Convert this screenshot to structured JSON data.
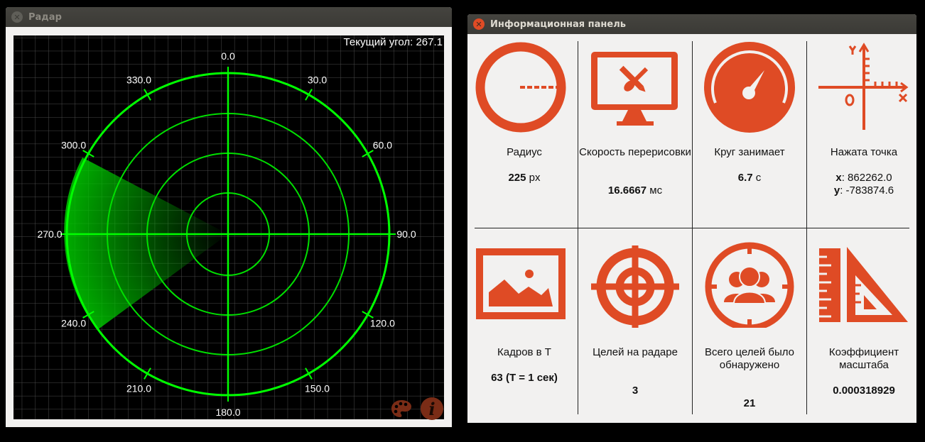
{
  "radar_window": {
    "title": "Радар",
    "current_angle_label": "Текущий угол: 267.1",
    "angle_labels": [
      "0.0",
      "30.0",
      "60.0",
      "90.0",
      "120.0",
      "150.0",
      "180.0",
      "210.0",
      "240.0",
      "270.0",
      "300.0",
      "330.0"
    ],
    "colors": {
      "background": "#000000",
      "grid": "#555555",
      "rings": "#00ff00",
      "accent": "#df4b25"
    },
    "icons": [
      "palette-icon",
      "info-icon"
    ]
  },
  "info_window": {
    "title": "Информационная панель",
    "accent": "#df4b25",
    "cells": [
      {
        "icon": "circle-radius-icon",
        "label": "Радиус",
        "value_bold": "225",
        "value_unit": " px"
      },
      {
        "icon": "monitor-paint-icon",
        "label": "Скорость перерисовки",
        "value_bold": "16.6667",
        "value_unit": " мс"
      },
      {
        "icon": "gauge-icon",
        "label": "Круг занимает",
        "value_bold": "6.7",
        "value_unit": " с"
      },
      {
        "icon": "axes-icon",
        "label": "Нажата точка",
        "x_label": "x",
        "x_value": ": 862262.0",
        "y_label": "y",
        "y_value": ": -783874.6"
      },
      {
        "icon": "picture-icon",
        "label": "Кадров в T",
        "value_bold": "63 (T = 1 сек)"
      },
      {
        "icon": "crosshair-icon",
        "label": "Целей на радаре",
        "value_bold": "3"
      },
      {
        "icon": "people-target-icon",
        "label": "Всего целей было обнаружено",
        "value_bold": "21"
      },
      {
        "icon": "ruler-triangle-icon",
        "label": "Коэффициент масштаба",
        "value_bold": "0.000318929"
      }
    ]
  }
}
